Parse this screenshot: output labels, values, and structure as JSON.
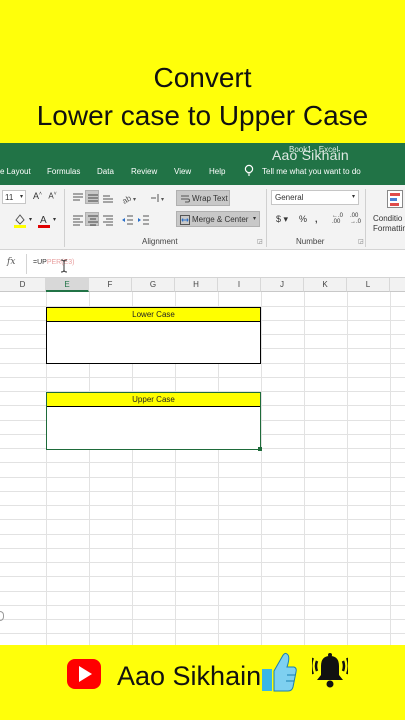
{
  "banner": {
    "line1": "Convert",
    "line2": "Lower case to Upper Case"
  },
  "window": {
    "title": "Book1 - Excel",
    "watermark": "Aao Sikhain"
  },
  "tabs": [
    "e Layout",
    "Formulas",
    "Data",
    "Review",
    "View",
    "Help"
  ],
  "tell_me": "Tell me what you want to do",
  "ribbon": {
    "font_size": "11",
    "wrap_text": "Wrap Text",
    "merge_center": "Merge & Center",
    "number_format": "General",
    "alignment_label": "Alignment",
    "number_label": "Number",
    "conditional_formatting": [
      "Conditio",
      "Formattin"
    ]
  },
  "formula_bar": {
    "fx": "fx",
    "formula_prefix": "=UP",
    "formula_ref": "PER(E3)"
  },
  "columns": [
    "D",
    "E",
    "F",
    "G",
    "H",
    "I",
    "J",
    "K",
    "L"
  ],
  "boxes": {
    "lower_label": "Lower Case",
    "upper_label": "Upper Case"
  },
  "footer": {
    "brand": "Aao Sikhain",
    "youtube_color": "#ff0000"
  }
}
